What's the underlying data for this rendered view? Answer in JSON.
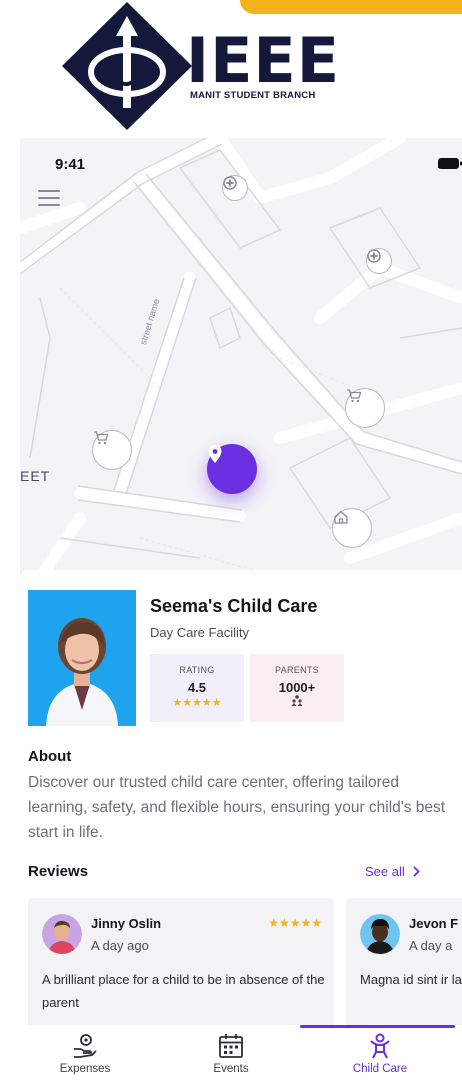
{
  "header": {
    "logo_word": "IEEE",
    "logo_subtitle": "MANIT STUDENT BRANCH",
    "accent_color": "#f5b21a",
    "brand_color": "#14183a"
  },
  "status_bar": {
    "time": "9:41",
    "icons": [
      "signal-icon",
      "wifi-icon",
      "battery-icon"
    ]
  },
  "map": {
    "street_label": "EET",
    "street_name": "street name",
    "markers": [
      "hospital-icon",
      "hospital-icon",
      "cart-icon",
      "cart-icon",
      "home-icon",
      "location-pin-icon"
    ]
  },
  "facility": {
    "name": "Seema's Child Care",
    "type": "Day Care Facility",
    "rating_label": "RATING",
    "rating_value": "4.5",
    "rating_stars": "★★★★★",
    "parents_label": "PARENTS",
    "parents_value": "1000+"
  },
  "about": {
    "title": "About",
    "text": "Discover our trusted child care center, offering tailored learning, safety, and flexible hours, ensuring your child's best start in life."
  },
  "reviews": {
    "title": "Reviews",
    "see_all": "See all",
    "items": [
      {
        "name": "Jinny Oslin",
        "time": "A day ago",
        "stars": "★★★★★",
        "text": "A brilliant place for a child to be in absence of the parent"
      },
      {
        "name": "Jevon F",
        "time": "A day a",
        "text": "Magna id sint ir laboris ullamco"
      }
    ]
  },
  "nav": {
    "items": [
      {
        "label": "Expenses",
        "icon": "hand-coin-icon"
      },
      {
        "label": "Events",
        "icon": "calendar-icon"
      },
      {
        "label": "Child Care",
        "icon": "child-icon"
      }
    ],
    "active": "Child Care",
    "active_color": "#6a2fe0"
  }
}
